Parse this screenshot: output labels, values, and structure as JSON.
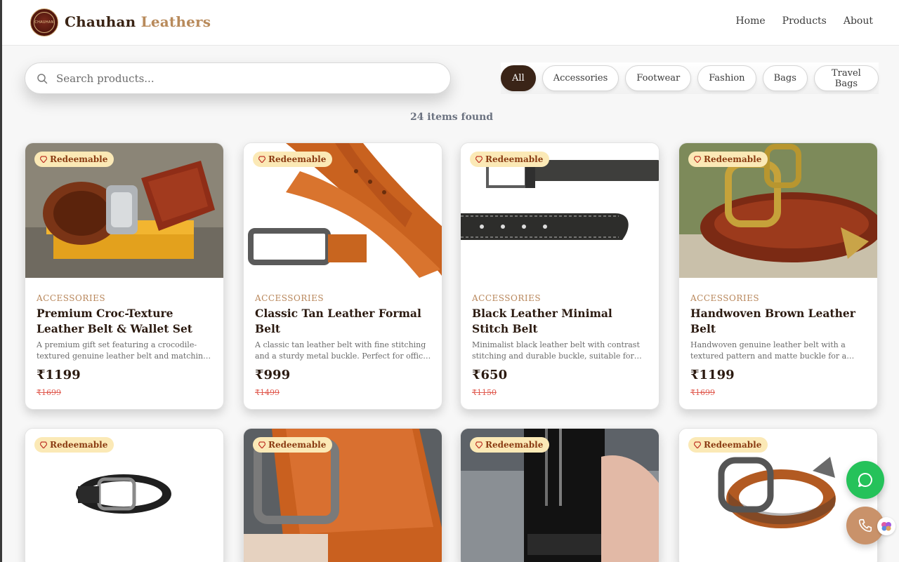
{
  "header": {
    "logo_text": "CHAUHAN",
    "brand_first": "Chauhan",
    "brand_second": "Leathers",
    "nav": [
      "Home",
      "Products",
      "About"
    ]
  },
  "search": {
    "placeholder": "Search products..."
  },
  "filters": [
    "All",
    "Accessories",
    "Footwear",
    "Fashion",
    "Bags",
    "Travel Bags"
  ],
  "active_filter": "All",
  "results_count": "24 items found",
  "badge_label": "Redeemable",
  "products": [
    {
      "category": "ACCESSORIES",
      "title": "Premium Croc-Texture Leather Belt & Wallet Set",
      "description": "A premium gift set featuring a crocodile-textured genuine leather belt and matching wallet.",
      "price": "₹1199",
      "old_price": "₹1699"
    },
    {
      "category": "ACCESSORIES",
      "title": "Classic Tan Leather Formal Belt",
      "description": "A classic tan leather belt with fine stitching and a sturdy metal buckle. Perfect for office and formal wear.",
      "price": "₹999",
      "old_price": "₹1499"
    },
    {
      "category": "ACCESSORIES",
      "title": "Black Leather Minimal Stitch Belt",
      "description": "Minimalist black leather belt with contrast stitching and durable buckle, suitable for daily use.",
      "price": "₹650",
      "old_price": "₹1150"
    },
    {
      "category": "ACCESSORIES",
      "title": "Handwoven Brown Leather Belt",
      "description": "Handwoven genuine leather belt with a textured pattern and matte buckle for a rugged look.",
      "price": "₹1199",
      "old_price": "₹1699"
    },
    {
      "category": "",
      "title": "",
      "description": "",
      "price": "",
      "old_price": ""
    },
    {
      "category": "",
      "title": "",
      "description": "",
      "price": "",
      "old_price": ""
    },
    {
      "category": "",
      "title": "",
      "description": "",
      "price": "",
      "old_price": ""
    },
    {
      "category": "",
      "title": "",
      "description": "",
      "price": "",
      "old_price": ""
    }
  ],
  "icons": {
    "search": "search-icon",
    "badge": "gem-icon",
    "whatsapp": "whatsapp-icon",
    "call": "phone-icon",
    "assistant": "brain-icon"
  },
  "colors": {
    "brand_dark": "#3a2417",
    "brand_accent": "#b88a5b",
    "whatsapp": "#25c25a",
    "call": "#c9926a",
    "old_price": "#e05a4f"
  }
}
